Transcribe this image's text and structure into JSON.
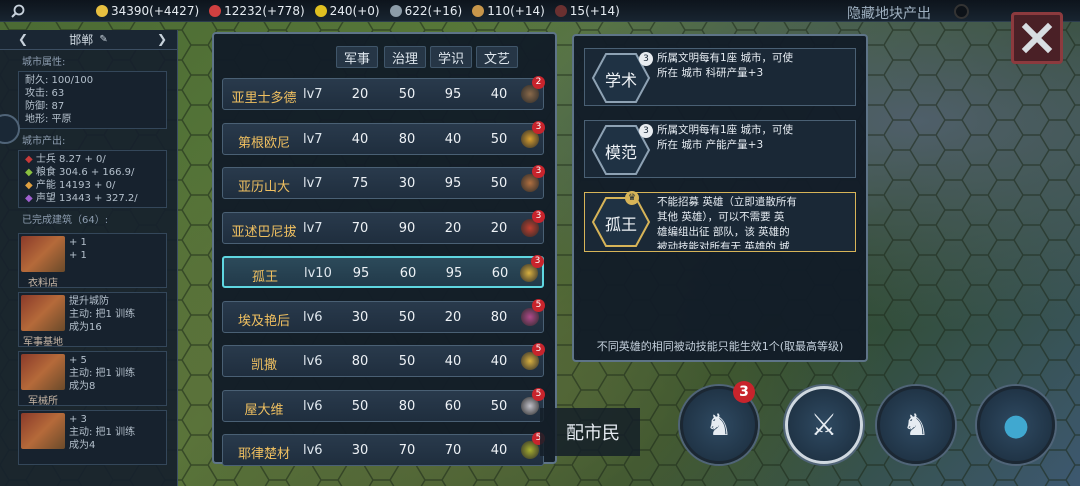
{
  "resources": [
    {
      "icon": "coin-icon",
      "value": "34390(+4427)",
      "color": "#e8c040"
    },
    {
      "icon": "telephone-icon",
      "value": "12232(+778)",
      "color": "#d04040"
    },
    {
      "icon": "radiation-icon",
      "value": "240(+0)",
      "color": "#e0c020"
    },
    {
      "icon": "tank-icon",
      "value": "622(+16)",
      "color": "#8c9ca8"
    },
    {
      "icon": "fist-icon",
      "value": "110(+14)",
      "color": "#c8964a"
    },
    {
      "icon": "dark-orb-icon",
      "value": "15(+14)",
      "color": "#6a3030"
    }
  ],
  "hide_tiles_label": "隐藏地块产出",
  "city": {
    "name": "邯郸",
    "attr_title": "城市属性:",
    "attrs": [
      "耐久: 100/100",
      "攻击: 63",
      "防御: 87",
      "地形: 平原"
    ],
    "output_title": "城市产出:",
    "outputs": [
      "士兵 8.27 + 0/",
      "粮食 304.6 + 166.9/",
      "产能 14193 + 0/",
      "声望 13443 + 327.2/"
    ],
    "built_title": "已完成建筑（64）:",
    "buildings": [
      {
        "label": "衣料店",
        "lines": [
          "+ 1",
          "+ 1"
        ]
      },
      {
        "label": "军事基地",
        "lines": [
          "提升城防",
          "主动: 把1 训练",
          "成为16"
        ]
      },
      {
        "label": "军械所",
        "lines": [
          "+ 5",
          "主动: 把1 训练",
          "成为8"
        ]
      },
      {
        "label": "",
        "lines": [
          "+ 3",
          "主动: 把1 训练",
          "成为4"
        ]
      }
    ]
  },
  "columns": [
    "军事",
    "治理",
    "学识",
    "文艺"
  ],
  "heroes": [
    {
      "name": "亚里士多德",
      "lv": "lv7",
      "stats": [
        "20",
        "50",
        "95",
        "40"
      ],
      "badge": "2",
      "color": "#8a6a4a"
    },
    {
      "name": "第根欧尼",
      "lv": "lv7",
      "stats": [
        "40",
        "80",
        "40",
        "50"
      ],
      "badge": "3",
      "color": "#d8a030"
    },
    {
      "name": "亚历山大",
      "lv": "lv7",
      "stats": [
        "75",
        "30",
        "95",
        "50"
      ],
      "badge": "3",
      "color": "#b07040"
    },
    {
      "name": "亚述巴尼拔",
      "lv": "lv7",
      "stats": [
        "70",
        "90",
        "20",
        "20"
      ],
      "badge": "3",
      "color": "#c04030"
    },
    {
      "name": "孤王",
      "lv": "lv10",
      "stats": [
        "95",
        "60",
        "95",
        "60"
      ],
      "badge": "3",
      "color": "#d8b040",
      "selected": true
    },
    {
      "name": "埃及艳后",
      "lv": "lv6",
      "stats": [
        "30",
        "50",
        "20",
        "80"
      ],
      "badge": "5",
      "color": "#b04a8a"
    },
    {
      "name": "凯撒",
      "lv": "lv6",
      "stats": [
        "80",
        "50",
        "40",
        "40"
      ],
      "badge": "5",
      "color": "#d8b040"
    },
    {
      "name": "屋大维",
      "lv": "lv6",
      "stats": [
        "50",
        "80",
        "60",
        "50"
      ],
      "badge": "5",
      "color": "#c0c0c8"
    },
    {
      "name": "耶律楚材",
      "lv": "lv6",
      "stats": [
        "30",
        "70",
        "70",
        "40"
      ],
      "badge": "5",
      "color": "#a8b030"
    }
  ],
  "skills": [
    {
      "name": "学术",
      "level": "3",
      "lines": [
        "所属文明每有1座 城市，可使",
        "所在 城市 科研产量+3"
      ]
    },
    {
      "name": "模范",
      "level": "3",
      "lines": [
        "所属文明每有1座 城市，可使",
        "所在 城市 产能产量+3"
      ]
    },
    {
      "name": "孤王",
      "level": "",
      "lines": [
        "不能招募 英雄（立即遣散所有",
        "其他 英雄），可以不需要 英",
        "雄编组出征 部队，该 英雄的",
        "被动技能对所有无 英雄的 城"
      ]
    }
  ],
  "skill_note": "不同英雄的相同被动技能只能生效1个(取最高等级)",
  "assign_label": "配市民",
  "bottom_buttons": [
    {
      "name": "heroes-button",
      "badge": "3"
    },
    {
      "name": "sword-shield-button",
      "badge": ""
    },
    {
      "name": "helmet-button",
      "badge": ""
    },
    {
      "name": "bomb-button",
      "badge": ""
    }
  ],
  "colors": {
    "accent": "#5fd6e0",
    "hero_name": "#f0c060",
    "badge": "#c8242c",
    "gold_border": "#d7b458"
  }
}
